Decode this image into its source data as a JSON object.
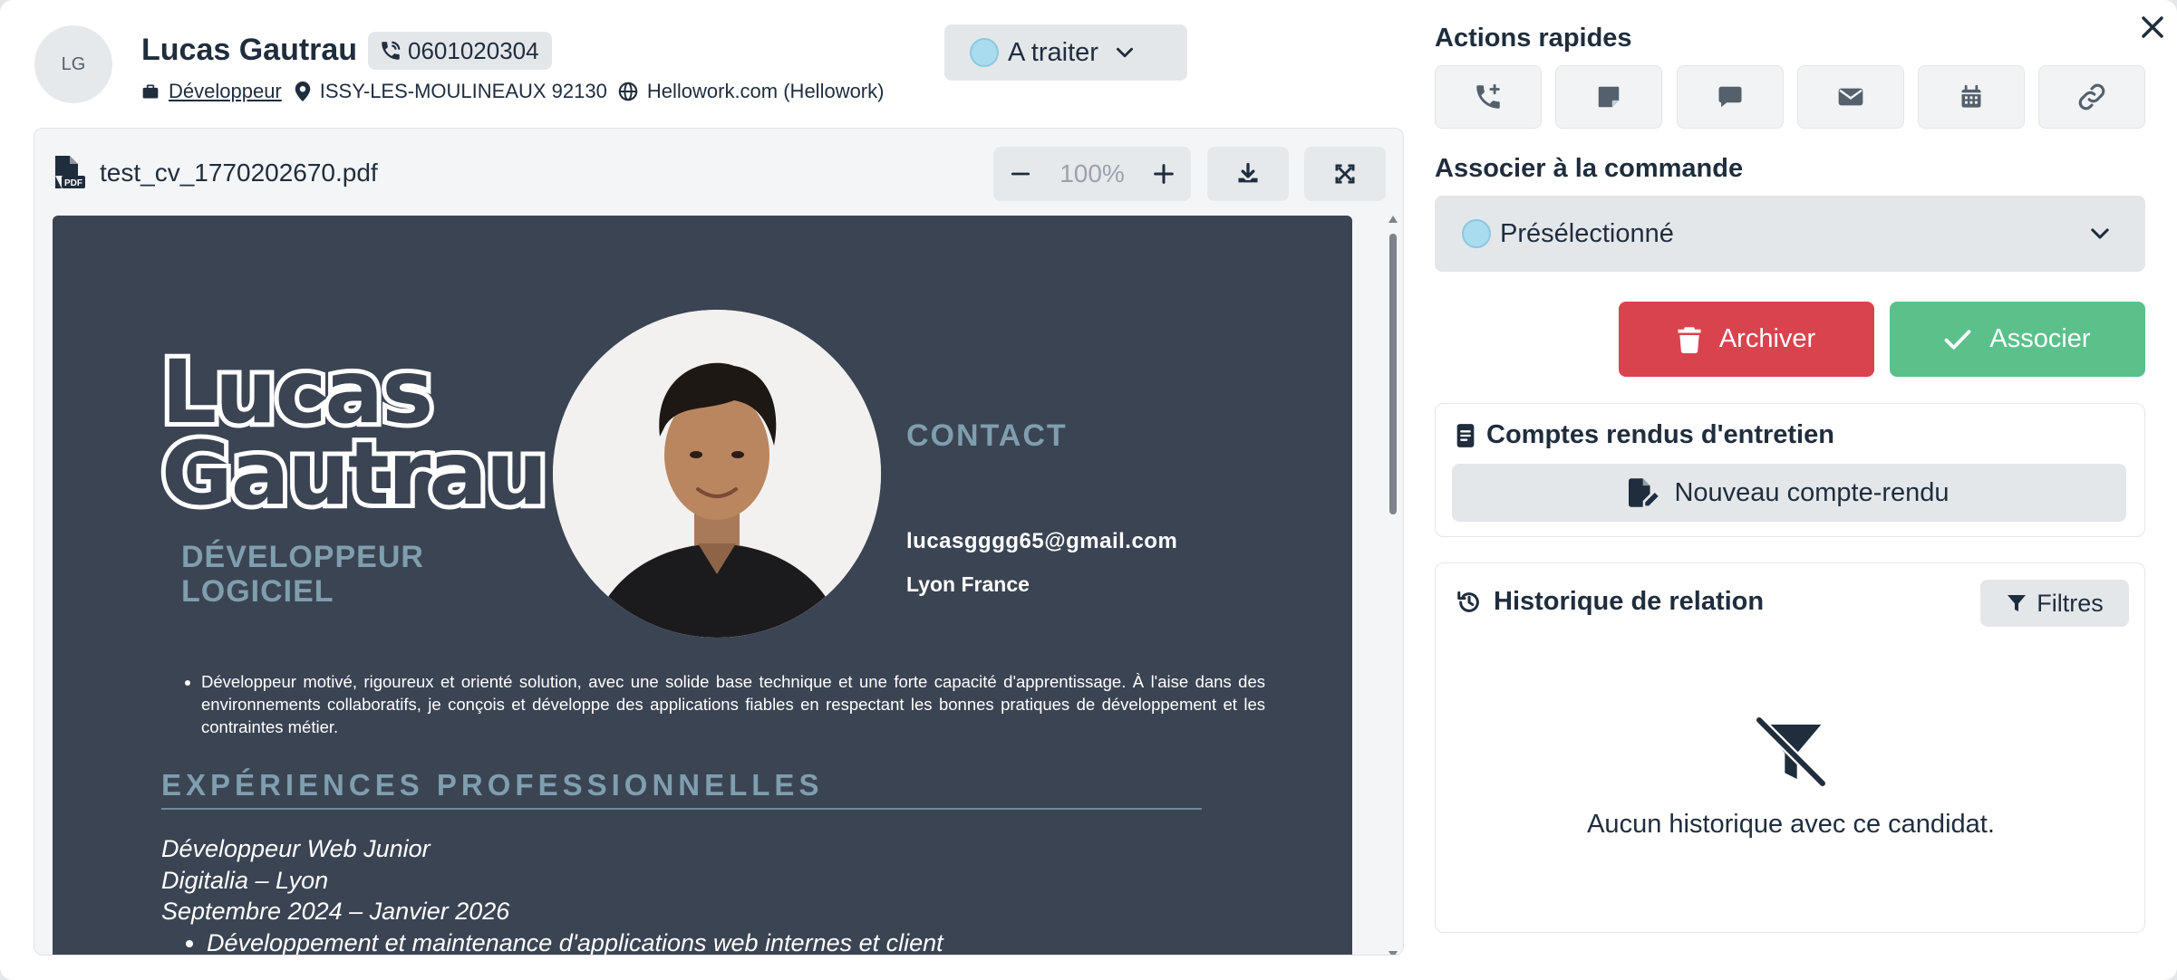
{
  "header": {
    "avatar_initials": "LG",
    "candidate_name": "Lucas Gautrau",
    "phone": "0601020304",
    "job": "Développeur",
    "location": "ISSY-LES-MOULINEAUX 92130",
    "source": "Hellowork.com (Hellowork)",
    "status": "A traiter",
    "status_color": "#a8dcee"
  },
  "viewer": {
    "file_name": "test_cv_1770202670.pdf",
    "zoom": "100%",
    "zoom_in_symbol": "+",
    "zoom_out_symbol": "−",
    "icons": [
      "pdf-file-icon",
      "download-icon",
      "fullscreen-icon"
    ]
  },
  "cv": {
    "first_name": "Lucas",
    "last_name": "Gautrau",
    "title_line1": "DÉVELOPPEUR",
    "title_line2": "LOGICIEL",
    "contact_heading": "CONTACT",
    "email": "lucasgggg65@gmail.com",
    "city": "Lyon France",
    "summary": "Développeur motivé, rigoureux et orienté solution, avec une solide base technique et une forte capacité d'apprentissage. À l'aise dans des environnements collaboratifs, je conçois et développe des applications fiables en respectant les bonnes pratiques de développement et les contraintes métier.",
    "experience_heading": "EXPÉRIENCES PROFESSIONNELLES",
    "exp_role": "Développeur Web Junior",
    "exp_company": "Digitalia – Lyon",
    "exp_dates": "Septembre 2024 – Janvier 2026",
    "exp_bullet": "Développement et maintenance d'applications web internes et client"
  },
  "quick_actions": {
    "title": "Actions rapides",
    "buttons": [
      "phone-add-icon",
      "note-icon",
      "chat-icon",
      "envelope-icon",
      "calendar-icon",
      "link-icon"
    ]
  },
  "order": {
    "title": "Associer à la commande",
    "selected": "Présélectionné",
    "dot_color": "#a8dcee",
    "archive_label": "Archiver",
    "associate_label": "Associer",
    "archive_color": "#d9434e",
    "associate_color": "#5cc08b"
  },
  "interviews": {
    "title": "Comptes rendus d'entretien",
    "new_label": "Nouveau compte-rendu"
  },
  "history": {
    "title": "Historique de relation",
    "filter_label": "Filtres",
    "empty_message": "Aucun historique avec ce candidat."
  }
}
